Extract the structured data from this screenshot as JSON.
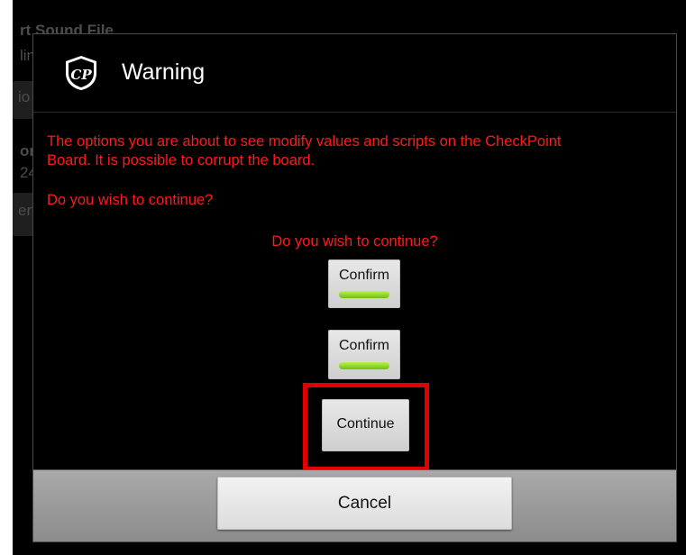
{
  "background": {
    "header_text": "rt Sound File",
    "subtext": "line B*",
    "button1_label": "io Alert",
    "section_label": "on",
    "value_text": "24.",
    "button2_label": "ert"
  },
  "dialog": {
    "title": "Warning",
    "logo_text": "CP",
    "message_line1": "The options you are about to see modify values and scripts on the CheckPoint",
    "message_line2": "Board.  It is possible to corrupt the board.",
    "question": "Do you wish to continue?",
    "prompt": "Do you wish to continue?",
    "confirm1_label": "Confirm",
    "confirm2_label": "Confirm",
    "continue_label": "Continue",
    "cancel_label": "Cancel"
  },
  "colors": {
    "message": "#ff1a1a",
    "highlight": "#e00000",
    "indicator": "#8fd82a"
  }
}
